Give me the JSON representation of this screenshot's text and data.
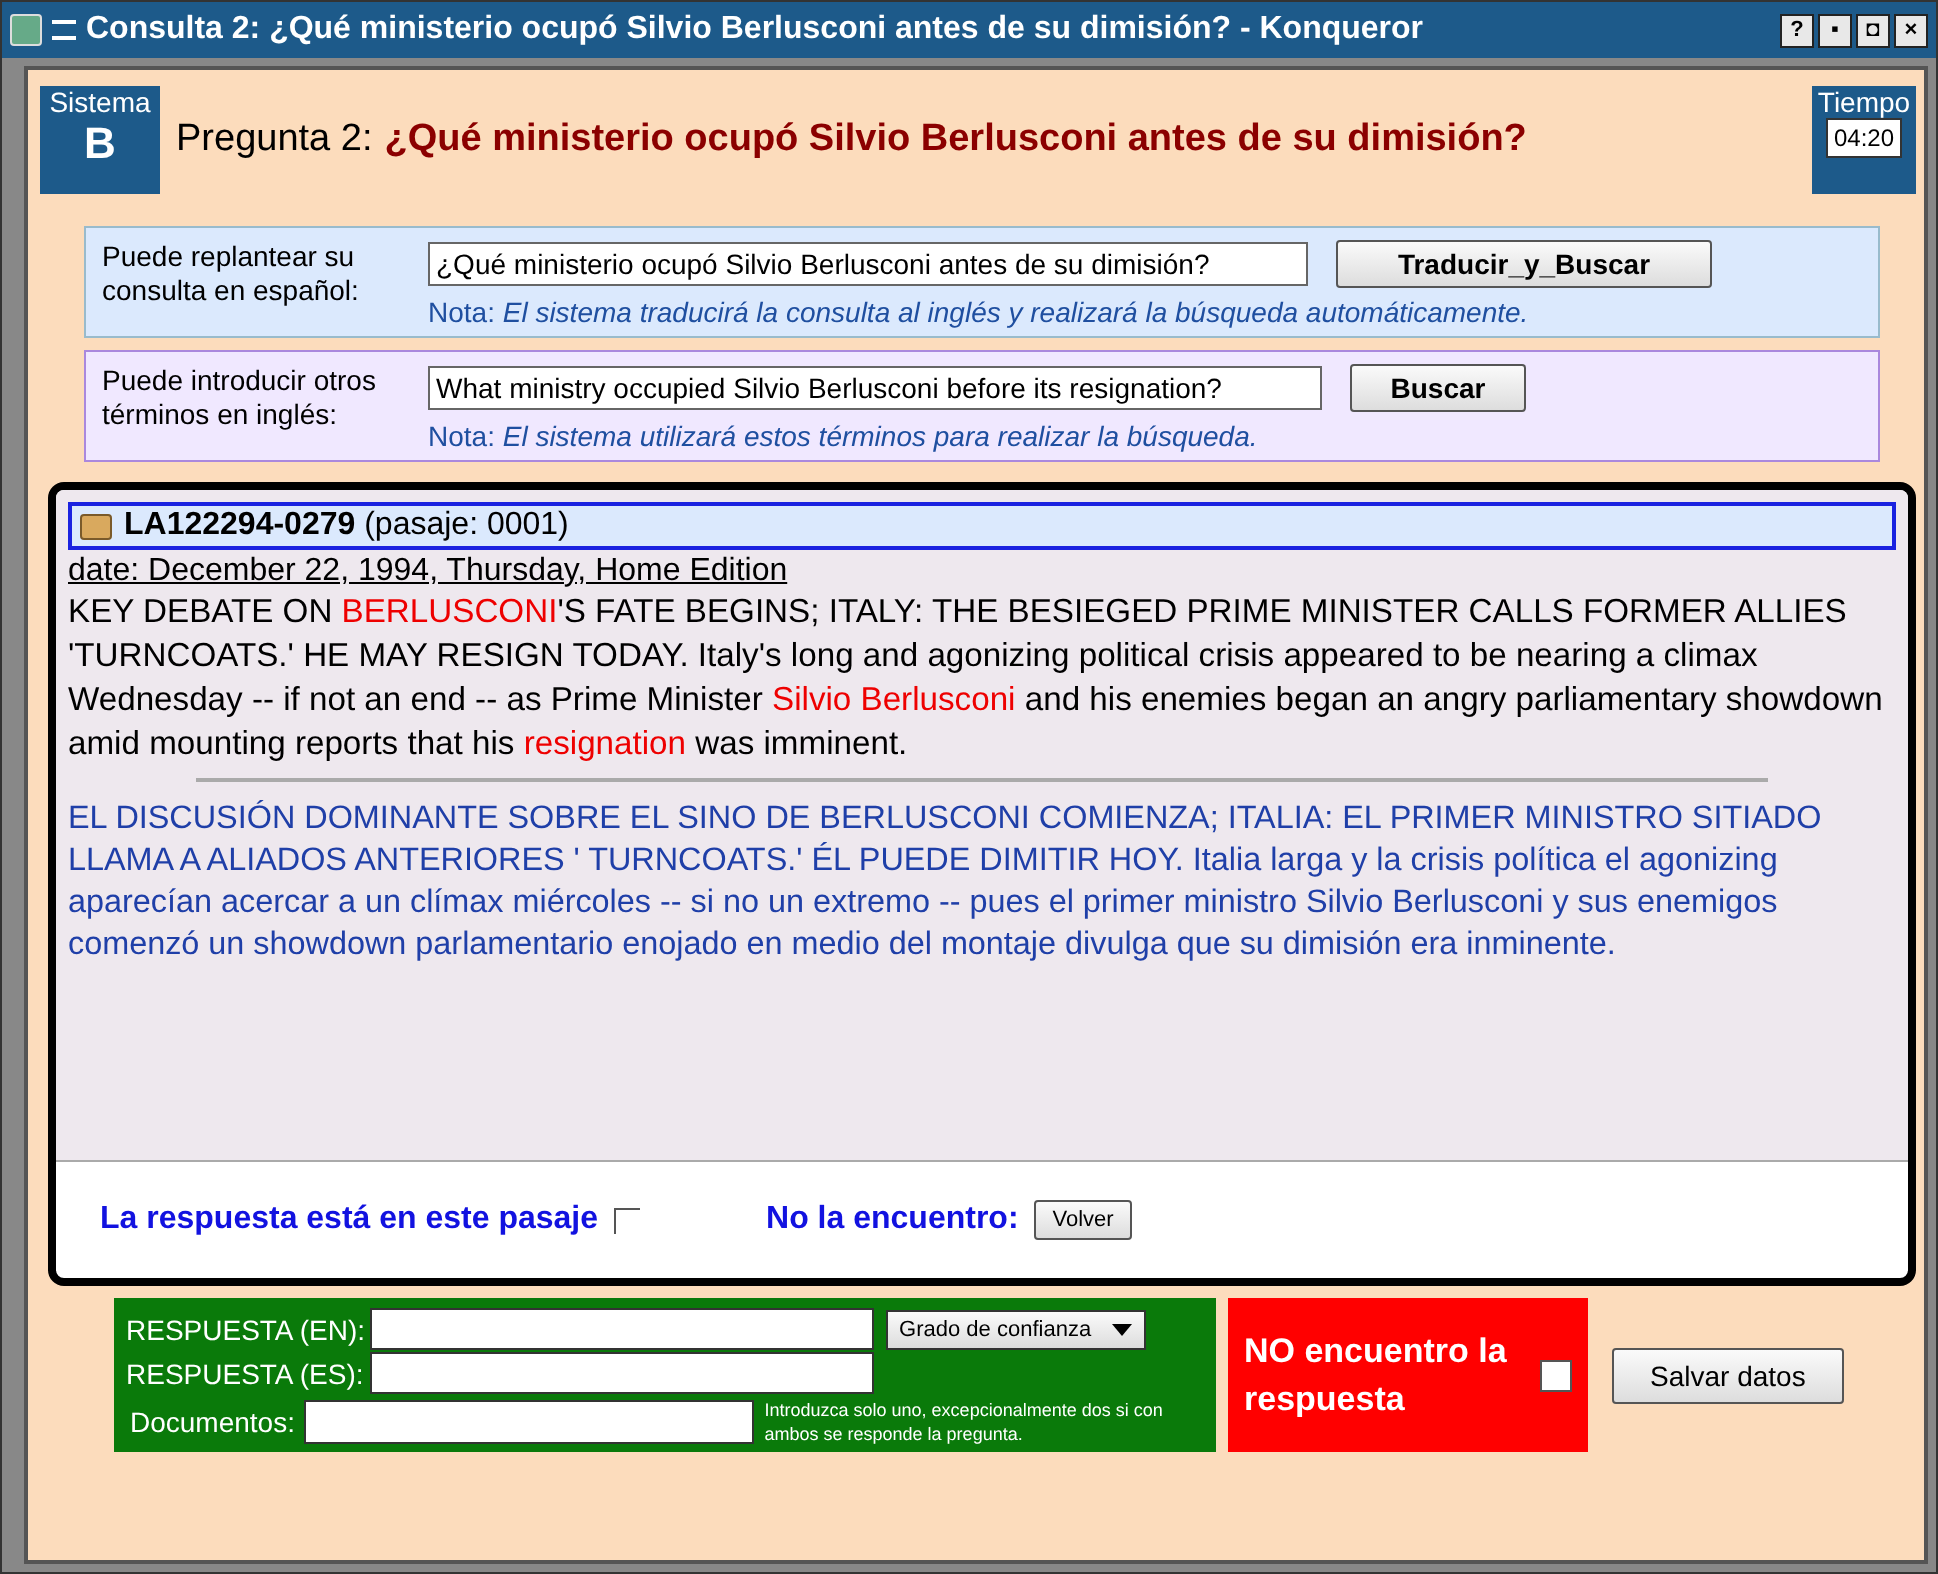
{
  "window": {
    "title": "Consulta 2: ¿Qué ministerio ocupó Silvio Berlusconi antes de su dimisión? - Konqueror",
    "buttons": [
      "?",
      "▪",
      "◘",
      "×"
    ]
  },
  "header": {
    "system_label": "Sistema",
    "system": "B",
    "question_label": "Pregunta 2:",
    "question": "¿Qué ministerio ocupó Silvio Berlusconi antes de su dimisión?",
    "time_label": "Tiempo",
    "time": "04:20"
  },
  "spanish_query": {
    "label": "Puede replantear su consulta en español:",
    "value": "¿Qué ministerio ocupó Silvio Berlusconi antes de su dimisión?",
    "button": "Traducir_y_Buscar",
    "note_label": "Nota:",
    "note": "El sistema traducirá la consulta al inglés y realizará la búsqueda automáticamente."
  },
  "english_query": {
    "label": "Puede introducir otros términos en inglés:",
    "value": "What ministry occupied Silvio Berlusconi before its resignation?",
    "button": "Buscar",
    "note_label": "Nota:",
    "note": "El sistema utilizará estos términos para realizar la búsqueda."
  },
  "passage": {
    "doc_id": "LA122294-0279",
    "passage_no": "(pasaje: 0001)",
    "date": "date: December 22, 1994, Thursday, Home Edition",
    "segments": [
      {
        "text": "KEY DEBATE ON ",
        "highlight": false
      },
      {
        "text": "BERLUSCONI",
        "highlight": true
      },
      {
        "text": "'S FATE BEGINS; ITALY: THE BESIEGED PRIME MINISTER CALLS FORMER ALLIES 'TURNCOATS.' HE MAY RESIGN TODAY. Italy's long and agonizing political crisis appeared to be nearing a climax Wednesday -- if not an end -- as Prime Minister ",
        "highlight": false
      },
      {
        "text": "Silvio Berlusconi",
        "highlight": true
      },
      {
        "text": " and his enemies began an angry parliamentary showdown amid mounting reports that his ",
        "highlight": false
      },
      {
        "text": "resignation",
        "highlight": true
      },
      {
        "text": " was imminent.",
        "highlight": false
      }
    ],
    "translation": "EL DISCUSIÓN DOMINANTE SOBRE EL SINO DE BERLUSCONI COMIENZA; ITALIA: EL PRIMER MINISTRO SITIADO LLAMA A ALIADOS ANTERIORES ' TURNCOATS.' ÉL PUEDE DIMITIR HOY. Italia larga y la crisis política el agonizing aparecían acercar a un clímax miércoles -- si no un extremo -- pues el primer ministro Silvio Berlusconi y sus enemigos comenzó un showdown parlamentario enojado en medio del montaje divulga que su dimisión era inminente.",
    "answer_here_label": "La respuesta está en este pasaje",
    "answer_here_checked": false,
    "not_found_label": "No la encuentro:",
    "back_button": "Volver"
  },
  "answer": {
    "en_label": "RESPUESTA (EN):",
    "es_label": "RESPUESTA (ES):",
    "docs_label": "Documentos:",
    "confidence": "Grado de confianza",
    "docs_hint": "Introduzca solo uno, excepcionalmente dos si con ambos se responde la pregunta.",
    "not_found_label": "NO encuentro la respuesta",
    "not_found_checked": false,
    "save_button": "Salvar datos"
  }
}
